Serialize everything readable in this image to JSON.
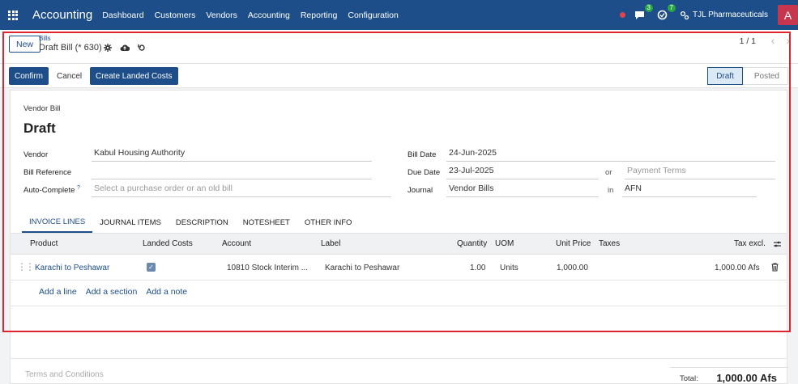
{
  "nav": {
    "brand": "Accounting",
    "menu": [
      "Dashboard",
      "Customers",
      "Vendors",
      "Accounting",
      "Reporting",
      "Configuration"
    ],
    "messages_badge": "3",
    "activities_badge": "7",
    "company": "TJL Pharmaceuticals",
    "avatar_letter": "A"
  },
  "control_panel": {
    "new_label": "New",
    "breadcrumb_parent": "Bills",
    "record_title": "Draft Bill (* 630)",
    "pager": "1 / 1"
  },
  "actions": {
    "confirm": "Confirm",
    "cancel": "Cancel",
    "landed_costs": "Create Landed Costs",
    "status_draft": "Draft",
    "status_posted": "Posted"
  },
  "form": {
    "doc_type": "Vendor Bill",
    "doc_name": "Draft",
    "vendor_label": "Vendor",
    "vendor_value": "Kabul Housing Authority",
    "bill_ref_label": "Bill Reference",
    "bill_ref_value": "",
    "autocomplete_label": "Auto-Complete",
    "autocomplete_help": "?",
    "autocomplete_placeholder": "Select a purchase order or an old bill",
    "bill_date_label": "Bill Date",
    "bill_date_value": "24-Jun-2025",
    "due_date_label": "Due Date",
    "due_date_value": "23-Jul-2025",
    "or_label": "or",
    "payment_terms_placeholder": "Payment Terms",
    "journal_label": "Journal",
    "journal_value": "Vendor Bills",
    "in_label": "in",
    "currency_value": "AFN"
  },
  "tabs": [
    "INVOICE LINES",
    "JOURNAL ITEMS",
    "DESCRIPTION",
    "NOTESHEET",
    "OTHER INFO"
  ],
  "lines": {
    "headers": {
      "product": "Product",
      "landed": "Landed Costs",
      "account": "Account",
      "label": "Label",
      "quantity": "Quantity",
      "uom": "UOM",
      "unit_price": "Unit Price",
      "taxes": "Taxes",
      "tax_excl": "Tax excl."
    },
    "rows": [
      {
        "product": "Karachi to Peshawar",
        "landed": true,
        "account": "10810 Stock Interim ...",
        "label": "Karachi to Peshawar",
        "quantity": "1.00",
        "uom": "Units",
        "unit_price": "1,000.00",
        "taxes": "",
        "tax_excl": "1,000.00 Afs"
      }
    ],
    "add_line": "Add a line",
    "add_section": "Add a section",
    "add_note": "Add a note"
  },
  "footer": {
    "terms_placeholder": "Terms and Conditions",
    "total_label": "Total:",
    "total_value": "1,000.00 Afs"
  }
}
